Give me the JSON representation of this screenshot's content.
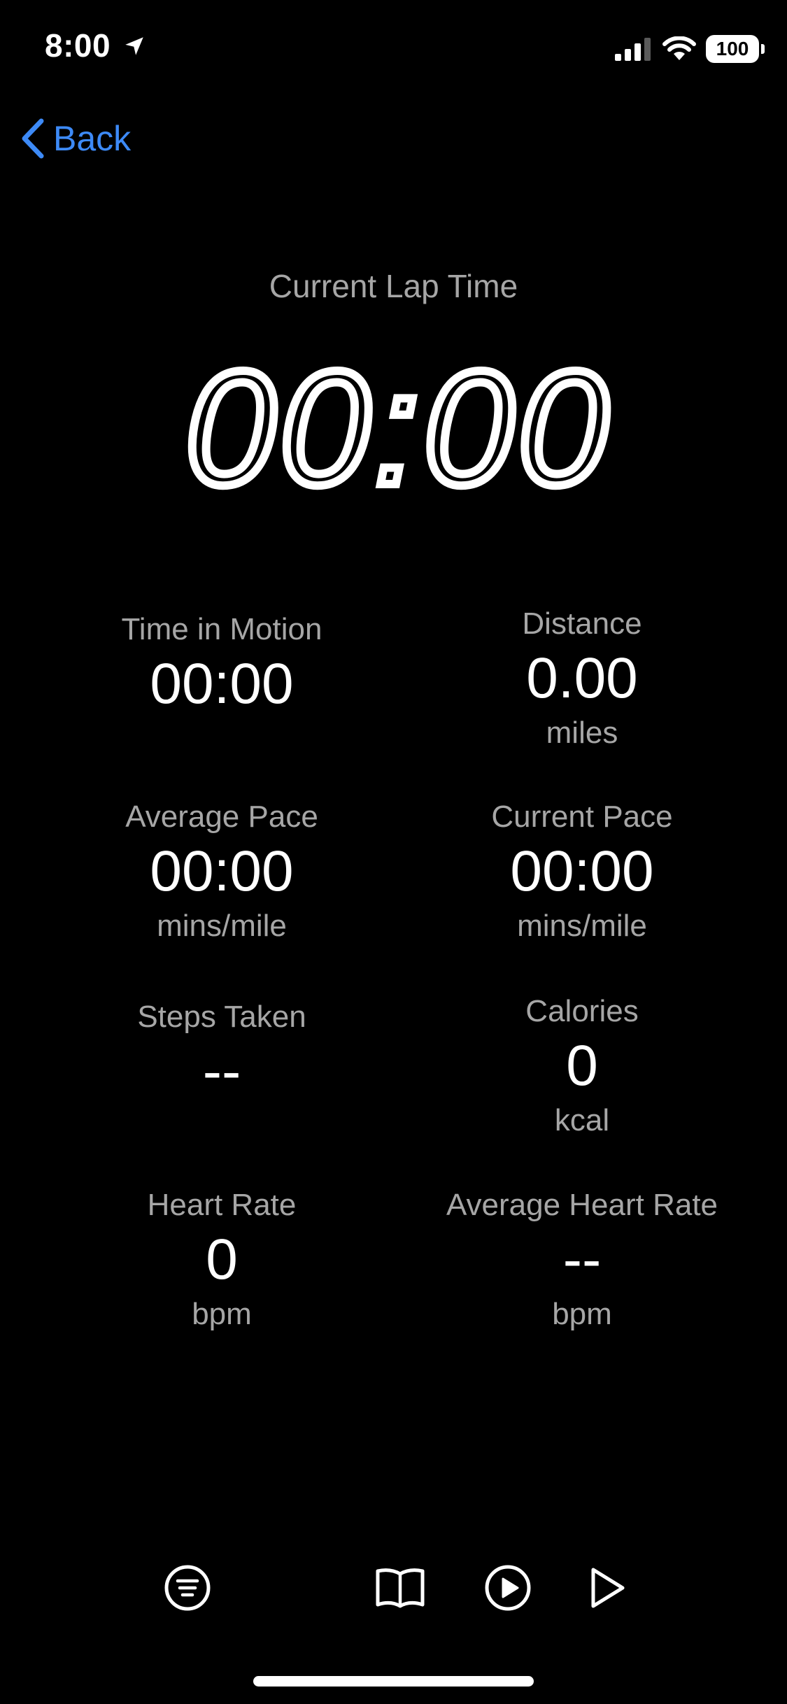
{
  "status_bar": {
    "time": "8:00",
    "battery": "100"
  },
  "nav": {
    "back_label": "Back"
  },
  "lap": {
    "label": "Current Lap Time",
    "value": "00:00"
  },
  "stats": {
    "time_in_motion": {
      "label": "Time in Motion",
      "value": "00:00"
    },
    "distance": {
      "label": "Distance",
      "value": "0.00",
      "unit": "miles"
    },
    "average_pace": {
      "label": "Average Pace",
      "value": "00:00",
      "unit": "mins/mile"
    },
    "current_pace": {
      "label": "Current Pace",
      "value": "00:00",
      "unit": "mins/mile"
    },
    "steps_taken": {
      "label": "Steps Taken",
      "value": "--"
    },
    "calories": {
      "label": "Calories",
      "value": "0",
      "unit": "kcal"
    },
    "heart_rate": {
      "label": "Heart Rate",
      "value": "0",
      "unit": "bpm"
    },
    "average_heart_rate": {
      "label": "Average Heart Rate",
      "value": "--",
      "unit": "bpm"
    }
  },
  "colors": {
    "background": "#000000",
    "accent": "#3d8af7",
    "label_gray": "#a6a6a6",
    "text": "#ffffff"
  },
  "toolbar": {
    "icons": [
      "list-circle-icon",
      "book-icon",
      "play-circle-icon",
      "play-icon"
    ]
  }
}
